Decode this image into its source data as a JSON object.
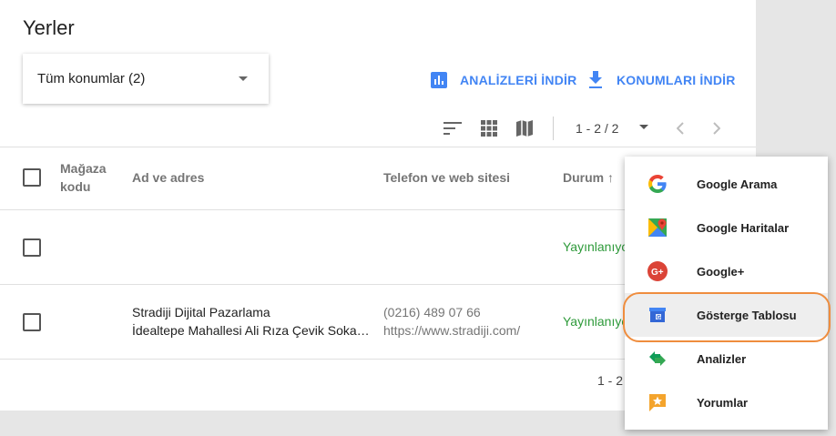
{
  "page": {
    "title": "Yerler"
  },
  "location_select": {
    "label": "Tüm konumlar (2)"
  },
  "actions": {
    "analytics": "ANALİZLERİ İNDİR",
    "download": "KONUMLARI İNDİR"
  },
  "pager": {
    "range": "1 - 2 / 2",
    "footer_range": "1 - 2 /"
  },
  "table": {
    "headers": {
      "store_code_line1": "Mağaza",
      "store_code_line2": "kodu",
      "name_address": "Ad ve adres",
      "phone_web": "Telefon ve web sitesi",
      "status": "Durum ↑"
    },
    "rows": [
      {
        "store_code": "",
        "name": "",
        "address": "",
        "phone": "",
        "website": "",
        "status": "Yayınlanıyor"
      },
      {
        "store_code": "",
        "name": "Stradiji Dijital Pazarlama",
        "address": "İdealtepe Mahallesi Ali Rıza Çevik Soka…",
        "phone": "(0216) 489 07 66",
        "website": "https://www.stradiji.com/",
        "status": "Yayınlanıyor"
      }
    ]
  },
  "menu": {
    "items": [
      {
        "label": "Google Arama",
        "icon": "google-g-icon"
      },
      {
        "label": "Google Haritalar",
        "icon": "google-maps-icon"
      },
      {
        "label": "Google+",
        "icon": "google-plus-icon"
      },
      {
        "label": "Gösterge Tablosu",
        "icon": "dashboard-icon"
      },
      {
        "label": "Analizler",
        "icon": "analytics-arrows-icon"
      },
      {
        "label": "Yorumlar",
        "icon": "reviews-star-icon"
      }
    ]
  },
  "colors": {
    "accent": "#4285f4",
    "status": "#2e9a3a",
    "highlight": "#ef8d3e"
  }
}
